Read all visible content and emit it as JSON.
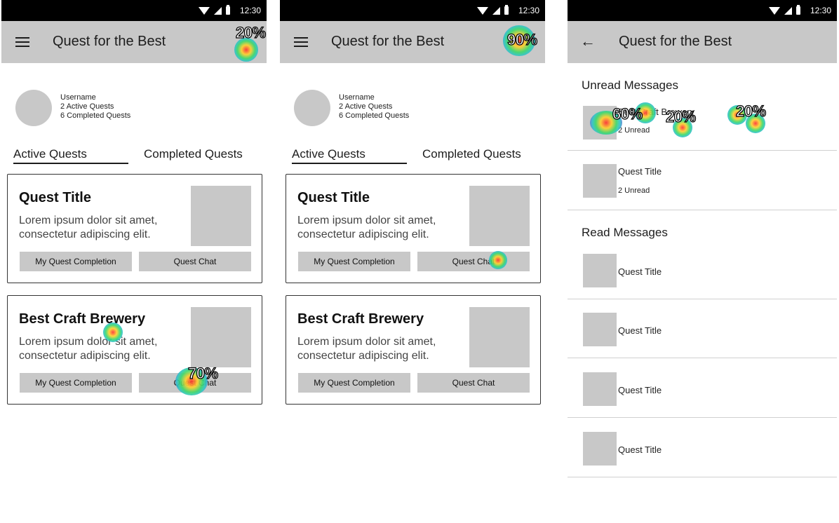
{
  "status_bar": {
    "time": "12:30"
  },
  "app_title": "Quest for the Best",
  "profile": {
    "username": "Username",
    "active_count": "2 Active Quests",
    "completed_count": "6 Completed Quests"
  },
  "tabs": {
    "active": "Active Quests",
    "completed": "Completed Quests"
  },
  "quests": [
    {
      "title": "Quest Title",
      "description": "Lorem ipsum dolor sit amet, consectetur adipiscing elit.",
      "completion_label": "My Quest Completion",
      "chat_label": "Quest Chat"
    },
    {
      "title": "Best Craft Brewery",
      "description": "Lorem ipsum dolor sit amet, consectetur adipiscing elit.",
      "completion_label": "My Quest Completion",
      "chat_label": "Quest Chat"
    }
  ],
  "messages": {
    "unread_header": "Unread Messages",
    "read_header": "Read Messages",
    "unread": [
      {
        "title": "Best Craft Brewery",
        "sub": "2 Unread"
      },
      {
        "title": "Quest Title",
        "sub": "2 Unread"
      }
    ],
    "read": [
      {
        "title": "Quest Title"
      },
      {
        "title": "Quest Title"
      },
      {
        "title": "Quest Title"
      },
      {
        "title": "Quest Title"
      }
    ]
  },
  "heatmap_labels": {
    "s1_menu": "20%",
    "s1_chat": "70%",
    "s2_menu": "90%",
    "s3_left": "60%",
    "s3_mid": "20%",
    "s3_right": "20%"
  },
  "colors": {
    "bar_gray": "#c8c8c8",
    "status_bar": "#000000"
  }
}
